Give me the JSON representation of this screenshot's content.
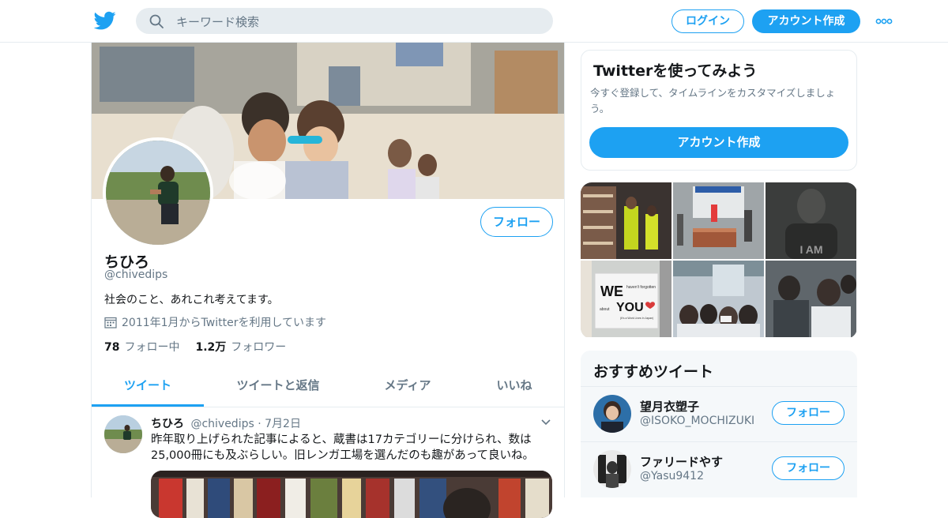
{
  "header": {
    "logo": "twitter-bird-icon",
    "search_placeholder": "キーワード検索",
    "login_label": "ログイン",
    "signup_label": "アカウント作成",
    "more_icon": "more-dots-icon"
  },
  "profile": {
    "name": "ちひろ",
    "handle": "@chivedips",
    "bio": "社会のこと、あれこれ考えてます。",
    "joined": "2011年1月からTwitterを利用しています",
    "following_count": "78",
    "following_label": "フォロー中",
    "followers_count": "1.2万",
    "followers_label": "フォロワー",
    "follow_label": "フォロー"
  },
  "tabs": [
    {
      "label": "ツイート",
      "active": true
    },
    {
      "label": "ツイートと返信",
      "active": false
    },
    {
      "label": "メディア",
      "active": false
    },
    {
      "label": "いいね",
      "active": false
    }
  ],
  "tweet": {
    "name": "ちひろ",
    "handle": "@chivedips",
    "separator": "·",
    "date": "7月2日",
    "text": "昨年取り上げられた記事によると、蔵書は17カテゴリーに分けられ、数は25,000冊にも及ぶらしい。旧レンガ工場を選んだのも趣があって良いね。"
  },
  "signup_card": {
    "title": "Twitterを使ってみよう",
    "subtitle": "今すぐ登録して、タイムラインをカスタマイズしましょう。",
    "button_label": "アカウント作成"
  },
  "media_grid": {
    "sign_text_we": "WE",
    "sign_text_small1": "haven't forgotten",
    "sign_text_about": "about",
    "sign_text_you": "YOU",
    "sign_text_small2": "(It's a Work Lives In Japan)",
    "shirt_text": "I AM"
  },
  "recommended": {
    "title": "おすすめツイート",
    "users": [
      {
        "name": "望月衣塑子",
        "handle": "@ISOKO_MOCHIZUKI",
        "button_label": "フォロー"
      },
      {
        "name": "ファリードやす",
        "handle": "@Yasu9412",
        "button_label": "フォロー"
      }
    ]
  },
  "colors": {
    "accent": "#1da1f2",
    "text_primary": "#14171a",
    "text_secondary": "#657786",
    "border": "#e6ecf0"
  }
}
